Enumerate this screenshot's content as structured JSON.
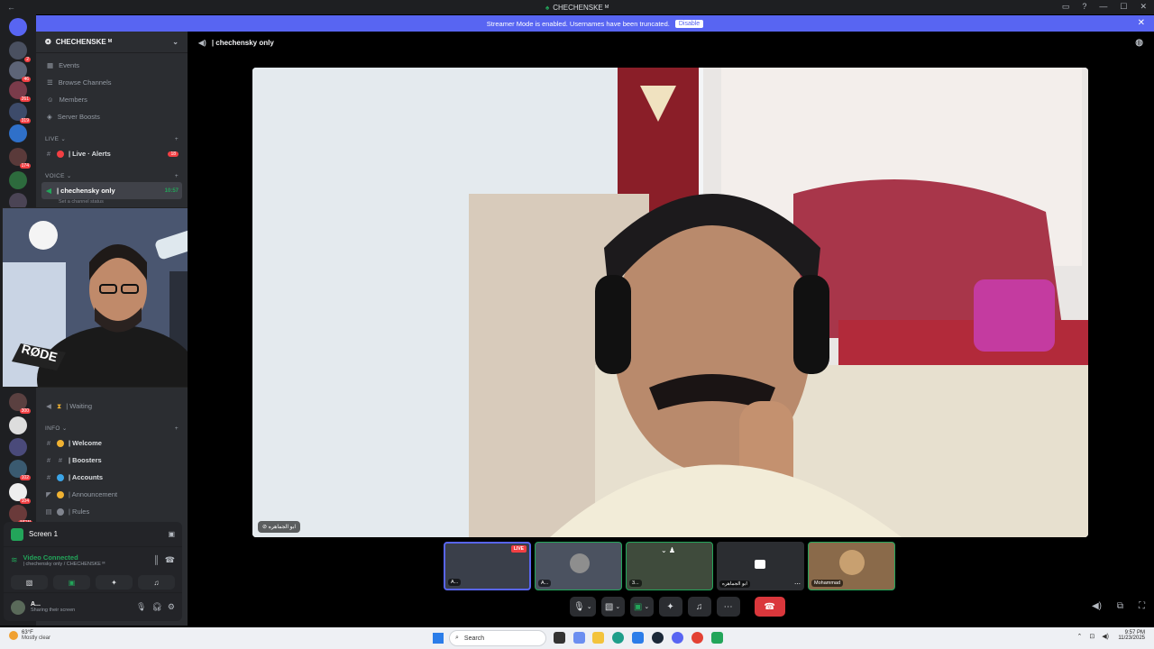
{
  "window": {
    "title": "CHECHENSKE ᴹ",
    "back": "←"
  },
  "banner": {
    "text": "Streamer Mode is enabled. Usernames have been truncated.",
    "disable": "Disable"
  },
  "guild_badges": [
    "2",
    "46",
    "261",
    "319",
    "174",
    "16",
    "300",
    "102",
    "104",
    "NEW"
  ],
  "server": {
    "name": "CHECHENSKE ᴹ"
  },
  "nav": [
    {
      "label": "Events",
      "icon": "calendar-icon"
    },
    {
      "label": "Browse Channels",
      "icon": "browse-icon"
    },
    {
      "label": "Members",
      "icon": "members-icon"
    },
    {
      "label": "Server Boosts",
      "icon": "boost-icon"
    }
  ],
  "categories": {
    "live": "LIVE",
    "voice": "VOICE",
    "info": "INFO"
  },
  "live_channel": {
    "label": "| Live · Alerts",
    "count": "18"
  },
  "voice_channel": {
    "label": "| chechensky only",
    "time": "10:57",
    "status": "Set a channel status"
  },
  "waiting_channel": {
    "label": "| Waiting"
  },
  "info_channels": [
    {
      "label": "| Welcome",
      "icon": "hand-icon",
      "color": "#f0b232"
    },
    {
      "label": "| Boosters",
      "icon": "hash-icon",
      "color": "#80848e"
    },
    {
      "label": "| Accounts",
      "icon": "globe-icon",
      "color": "#3ba5e8"
    },
    {
      "label": "| Announcement",
      "icon": "megaphone-icon",
      "color": "#f0b232"
    },
    {
      "label": "| Rules",
      "icon": "book-icon",
      "color": "#80848e"
    }
  ],
  "voice_panel": {
    "screen": "Screen 1",
    "connected": "Video Connected",
    "channel_path": "| chechensky only / CHECHENSKE ᴹ",
    "user": "A...",
    "user_status": "Sharing their screen"
  },
  "header": {
    "channel": "| chechensky only"
  },
  "main_video": {
    "name": "ابو الجماهره"
  },
  "tiles": [
    {
      "label": "A...",
      "live": "LIVE"
    },
    {
      "label": "A..."
    },
    {
      "label": "3..."
    },
    {
      "label": "ابو الجماهره"
    },
    {
      "label": "Mohammad"
    }
  ],
  "taskbar": {
    "weather_temp": "63°F",
    "weather_desc": "Mostly clear",
    "search": "Search",
    "time": "9:57 PM",
    "date": "11/23/2025"
  },
  "colors": {
    "accent": "#5865f2",
    "danger": "#da373c",
    "green": "#23a55a"
  }
}
